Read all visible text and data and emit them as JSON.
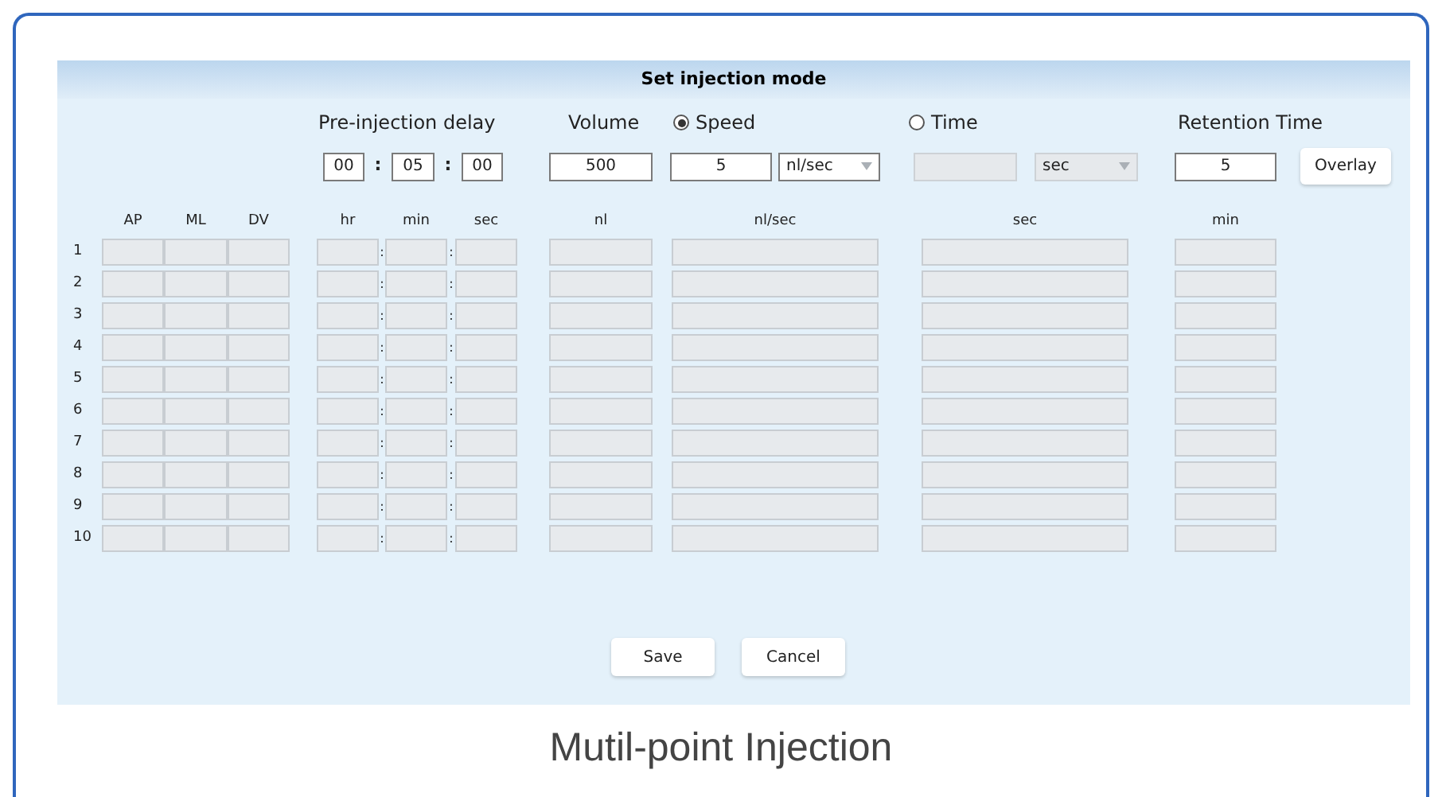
{
  "dialog": {
    "title": "Set injection mode"
  },
  "settings": {
    "delay_label": "Pre-injection delay",
    "delay_fields": [
      "00",
      "05",
      "00"
    ],
    "delay_separators": [
      ":",
      ":"
    ],
    "volume_label": "Volume",
    "volume_value": "500",
    "modes": [
      {
        "label": "Speed",
        "selected": true
      },
      {
        "label": "Time",
        "selected": false
      }
    ],
    "speed_value": "5",
    "speed_unit": {
      "value": "nl/sec",
      "disabled": false
    },
    "time_field": {
      "disabled": true
    },
    "time_unit": {
      "value": "sec",
      "disabled": true
    },
    "retention_label": "Retention Time",
    "retention_value": "5",
    "overlay_button": "Overlay"
  },
  "table": {
    "columns": [
      "AP",
      "ML",
      "DV",
      "hr",
      "min",
      "sec",
      "nl",
      "nl/sec",
      "sec",
      "min"
    ],
    "rows": [
      {
        "number": "1",
        "separators": [
          ":",
          ":"
        ]
      },
      {
        "number": "2",
        "separators": [
          ":",
          ":"
        ]
      },
      {
        "number": "3",
        "separators": [
          ":",
          ":"
        ]
      },
      {
        "number": "4",
        "separators": [
          ":",
          ":"
        ]
      },
      {
        "number": "5",
        "separators": [
          ":",
          ":"
        ]
      },
      {
        "number": "6",
        "separators": [
          ":",
          ":"
        ]
      },
      {
        "number": "7",
        "separators": [
          ":",
          ":"
        ]
      },
      {
        "number": "8",
        "separators": [
          ":",
          ":"
        ]
      },
      {
        "number": "9",
        "separators": [
          ":",
          ":"
        ]
      },
      {
        "number": "10",
        "separators": [
          ":",
          ":"
        ]
      }
    ]
  },
  "buttons": [
    "Save",
    "Cancel"
  ],
  "caption": "Mutil-point Injection"
}
